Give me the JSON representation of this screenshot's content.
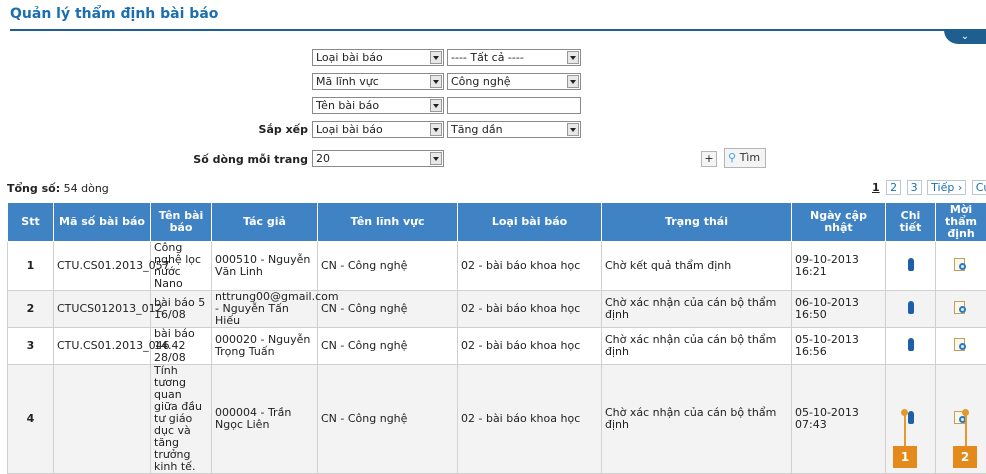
{
  "page": {
    "title": "Quản lý thẩm định bài báo",
    "collapse_icon": "chevron-down-icon"
  },
  "filters": {
    "row1": {
      "field": "Loại bài báo",
      "value": "---- Tất cả ----"
    },
    "row2": {
      "field": "Mã lĩnh vực",
      "value": "Công nghệ"
    },
    "row3": {
      "field": "Tên bài báo",
      "value": ""
    },
    "sort": {
      "label": "Sắp xếp",
      "field": "Loại bài báo",
      "order": "Tăng dần"
    },
    "page_size": {
      "label": "Số dòng mỗi trang",
      "value": "20"
    },
    "plus_label": "+",
    "search_label": "Tìm"
  },
  "summary": {
    "total_label": "Tổng số:",
    "total_value": "54 dòng"
  },
  "pager": {
    "current": "1",
    "pages": [
      "2",
      "3"
    ],
    "next": "Tiếp ›",
    "last": "Cuối »"
  },
  "table": {
    "headers": [
      "Stt",
      "Mã số bài báo",
      "Tên bài báo",
      "Tác giả",
      "Tên lĩnh vực",
      "Loại bài báo",
      "Trạng thái",
      "Ngày cập nhật",
      "Chi tiết",
      "Mời thẩm định"
    ],
    "rows": [
      {
        "stt": "1",
        "code": "CTU.CS01.2013_057",
        "title": "Công nghệ lọc nước Nano",
        "author": "000510 - Nguyễn Văn Linh",
        "field": "CN - Công nghệ",
        "type": "02 - bài báo khoa học",
        "status": "Chờ kết quả thẩm định",
        "date": "09-10-2013 16:21"
      },
      {
        "stt": "2",
        "code": "CTUCS012013_012",
        "title": "bài báo 5 16/08",
        "author": "nttrung00@gmail.com - Nguyễn Tấn Hiếu",
        "field": "CN - Công nghệ",
        "type": "02 - bài báo khoa học",
        "status": "Chờ xác nhận của cán bộ thẩm định",
        "date": "06-10-2013 16:50"
      },
      {
        "stt": "3",
        "code": "CTU.CS01.2013_046",
        "title": "bài báo 14.42 28/08",
        "author": "000020 - Nguyễn Trọng Tuấn",
        "field": "CN - Công nghệ",
        "type": "02 - bài báo khoa học",
        "status": "Chờ xác nhận của cán bộ thẩm định",
        "date": "05-10-2013 16:56"
      },
      {
        "stt": "4",
        "code": "",
        "title": "Tính tương quan giữa đầu tư giáo dục và tăng trưởng kinh tế.",
        "author": "000004 - Trần Ngọc Liên",
        "field": "CN - Công nghệ",
        "type": "02 - bài báo khoa học",
        "status": "Chờ xác nhận của cán bộ thẩm định",
        "date": "05-10-2013 07:43"
      }
    ]
  },
  "callouts": [
    "1",
    "2"
  ],
  "colors": {
    "header_bg": "#3f83c4",
    "title": "#1b6fb0",
    "callout": "#e48a1c"
  }
}
